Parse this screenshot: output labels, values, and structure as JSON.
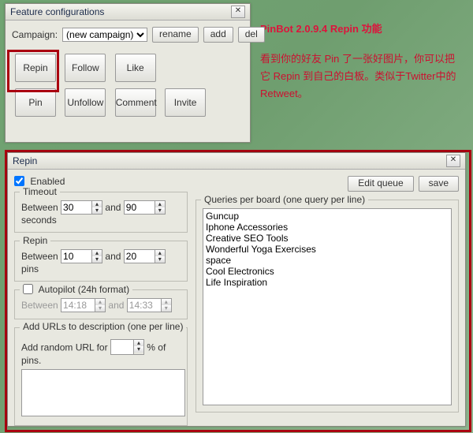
{
  "feature_window": {
    "title": "Feature configurations",
    "campaign_label": "Campaign:",
    "campaign_selected": "(new campaign)",
    "rename_btn": "rename",
    "add_btn": "add",
    "del_btn": "del",
    "buttons": {
      "repin": "Repin",
      "follow": "Follow",
      "like": "Like",
      "pin": "Pin",
      "unfollow": "Unfollow",
      "comment": "Comment",
      "invite": "Invite"
    }
  },
  "side": {
    "title": "PinBot 2.0.9.4 Repin 功能",
    "body": "看到你的好友 Pin 了一张好图片，你可以把它 Repin 到自己的白板。类似于Twitter中的 Retweet。"
  },
  "repin_window": {
    "title": "Repin",
    "enabled_label": "Enabled",
    "edit_queue_btn": "Edit queue",
    "save_btn": "save",
    "timeout": {
      "legend": "Timeout",
      "between": "Between",
      "and": "and",
      "min": "30",
      "max": "90",
      "unit": "seconds"
    },
    "repin_range": {
      "legend": "Repin",
      "between": "Between",
      "and": "and",
      "min": "10",
      "max": "20",
      "unit": "pins"
    },
    "autopilot": {
      "label": "Autopilot (24h format)",
      "between": "Between",
      "and": "and",
      "t1": "14:18",
      "t2": "14:33"
    },
    "urls": {
      "legend": "Add URLs to description (one per line)",
      "random_label_a": "Add random URL for",
      "random_label_b": "% of pins."
    },
    "queries": {
      "legend": "Queries per board (one query per line)",
      "text": "Guncup\nIphone Accessories\nCreative SEO Tools\nWonderful Yoga Exercises\nspace\nCool Electronics\nLife Inspiration"
    }
  },
  "icons": {
    "x": "✕",
    "up": "▴",
    "down": "▾"
  }
}
